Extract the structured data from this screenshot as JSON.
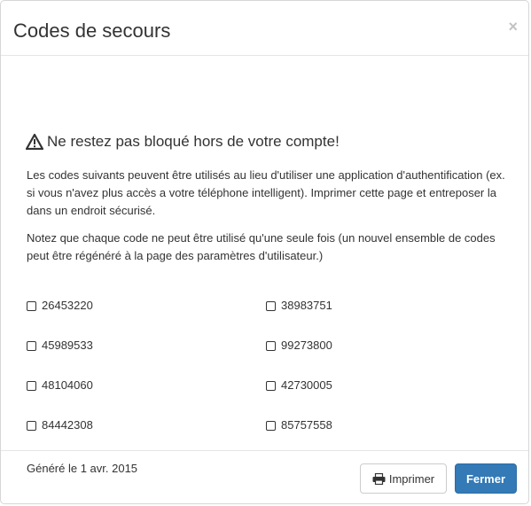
{
  "modal": {
    "title": "Codes de secours",
    "close_symbol": "×"
  },
  "body": {
    "heading": "Ne restez pas bloqué hors de votre compte!",
    "heading_icon": "warning-triangle-icon",
    "paragraph1": "Les codes suivants peuvent être utilisés au lieu d'utiliser une application d'authentification (ex. si vous n'avez plus accès a votre téléphone intelligent). Imprimer cette page et entreposer la dans un endroit sécurisé.",
    "paragraph2": "Notez que chaque code ne peut être utilisé qu'une seule fois (un nouvel ensemble de codes peut être régénéré à la page des paramètres d'utilisateur.)",
    "codes": [
      "26453220",
      "38983751",
      "45989533",
      "99273800",
      "48104060",
      "42730005",
      "84442308",
      "85757558"
    ],
    "generated": "Généré le 1 avr. 2015"
  },
  "footer": {
    "print_label": "Imprimer",
    "print_icon": "printer-icon",
    "close_label": "Fermer"
  },
  "colors": {
    "primary": "#337ab7",
    "text": "#333333",
    "border": "#e5e5e5"
  }
}
